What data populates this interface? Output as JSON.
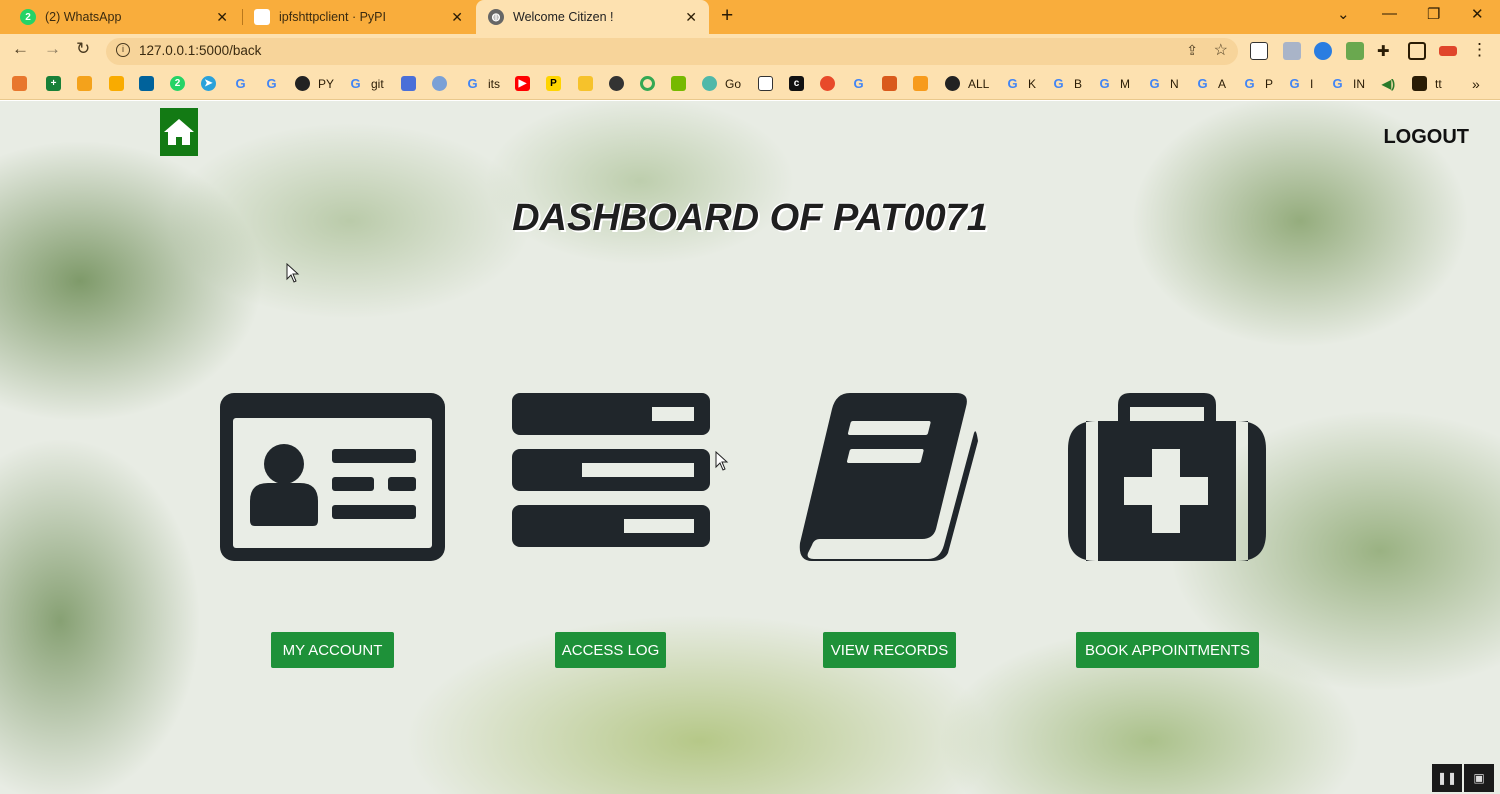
{
  "tabs": [
    {
      "label": "(2) WhatsApp",
      "icon": "whatsapp-icon",
      "badge": "2"
    },
    {
      "label": "ipfshttpclient · PyPI",
      "icon": "pypi-icon"
    },
    {
      "label": "Welcome Citizen !",
      "icon": "globe-icon"
    }
  ],
  "url": "127.0.0.1:5000/back",
  "bookmarks": [
    {
      "label": "PY"
    },
    {
      "label": "git"
    },
    {
      "label": "its"
    },
    {
      "label": "Go"
    },
    {
      "label": "ALL"
    },
    {
      "label": "K"
    },
    {
      "label": "B"
    },
    {
      "label": "M"
    },
    {
      "label": "N"
    },
    {
      "label": "A"
    },
    {
      "label": "P"
    },
    {
      "label": "I"
    },
    {
      "label": "IN"
    },
    {
      "label": "tt"
    }
  ],
  "page": {
    "logout": "LOGOUT",
    "title": "DASHBOARD OF PAT0071",
    "cards": [
      {
        "button": "MY ACCOUNT",
        "icon": "id-card-icon"
      },
      {
        "button": "ACCESS LOG",
        "icon": "server-list-icon"
      },
      {
        "button": "VIEW RECORDS",
        "icon": "book-icon"
      },
      {
        "button": "BOOK APPOINTMENTS",
        "icon": "medical-kit-icon"
      }
    ]
  },
  "colors": {
    "tabbar": "#f9ad3c",
    "toolbar": "#fde1b0",
    "button_green": "#1e9139",
    "home_green": "#137a14",
    "icon_dark": "#20262b"
  }
}
